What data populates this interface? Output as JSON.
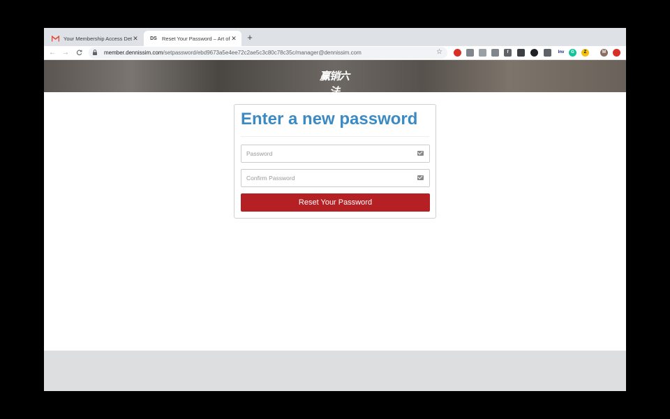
{
  "tabs": [
    {
      "title": "Your Membership Access Detail",
      "favicon": "gmail-icon",
      "favicon_color": "#ea4335",
      "active": false
    },
    {
      "title": "Reset Your Password – Art of Ma",
      "favicon": "DS",
      "active": true
    }
  ],
  "new_tab_label": "+",
  "toolbar": {
    "back_icon": "←",
    "forward_icon": "→",
    "reload_icon": "C",
    "url_host": "member.dennissim.com",
    "url_path": "/setpassword/ebd9673a5e4ee72c2ae5c3c80c78c35c/manager@dennissim.com",
    "star_icon": "☆",
    "extensions": [
      {
        "name": "extension-badge-icon",
        "label": "",
        "color": "#d93025"
      },
      {
        "name": "camera-icon",
        "label": "",
        "color": "#80868b"
      },
      {
        "name": "code-icon",
        "label": "",
        "color": "#9aa0a6"
      },
      {
        "name": "page-icon",
        "label": "",
        "color": "#80868b"
      },
      {
        "name": "facebook-icon",
        "label": "f",
        "color": "#5f6368"
      },
      {
        "name": "extension-icon",
        "label": "",
        "color": "#3c4043"
      },
      {
        "name": "circle-icon",
        "label": "",
        "color": "#202124"
      },
      {
        "name": "pen-icon",
        "label": "",
        "color": "#5f6368"
      },
      {
        "name": "inv-icon",
        "label": "Inv",
        "color": "#1a237e"
      },
      {
        "name": "grammarly-icon",
        "label": "G",
        "color": "#15c39a"
      },
      {
        "name": "z-icon",
        "label": "Z",
        "color": "#f4c20d"
      },
      {
        "name": "profile-avatar",
        "label": "M",
        "color": "#8d6e63"
      },
      {
        "name": "update-icon",
        "label": "",
        "color": "#d93025"
      }
    ]
  },
  "banner": {
    "logo_text": "赢销六法"
  },
  "form": {
    "title": "Enter a new password",
    "password_placeholder": "Password",
    "confirm_placeholder": "Confirm Password",
    "submit_label": "Reset Your Password"
  }
}
